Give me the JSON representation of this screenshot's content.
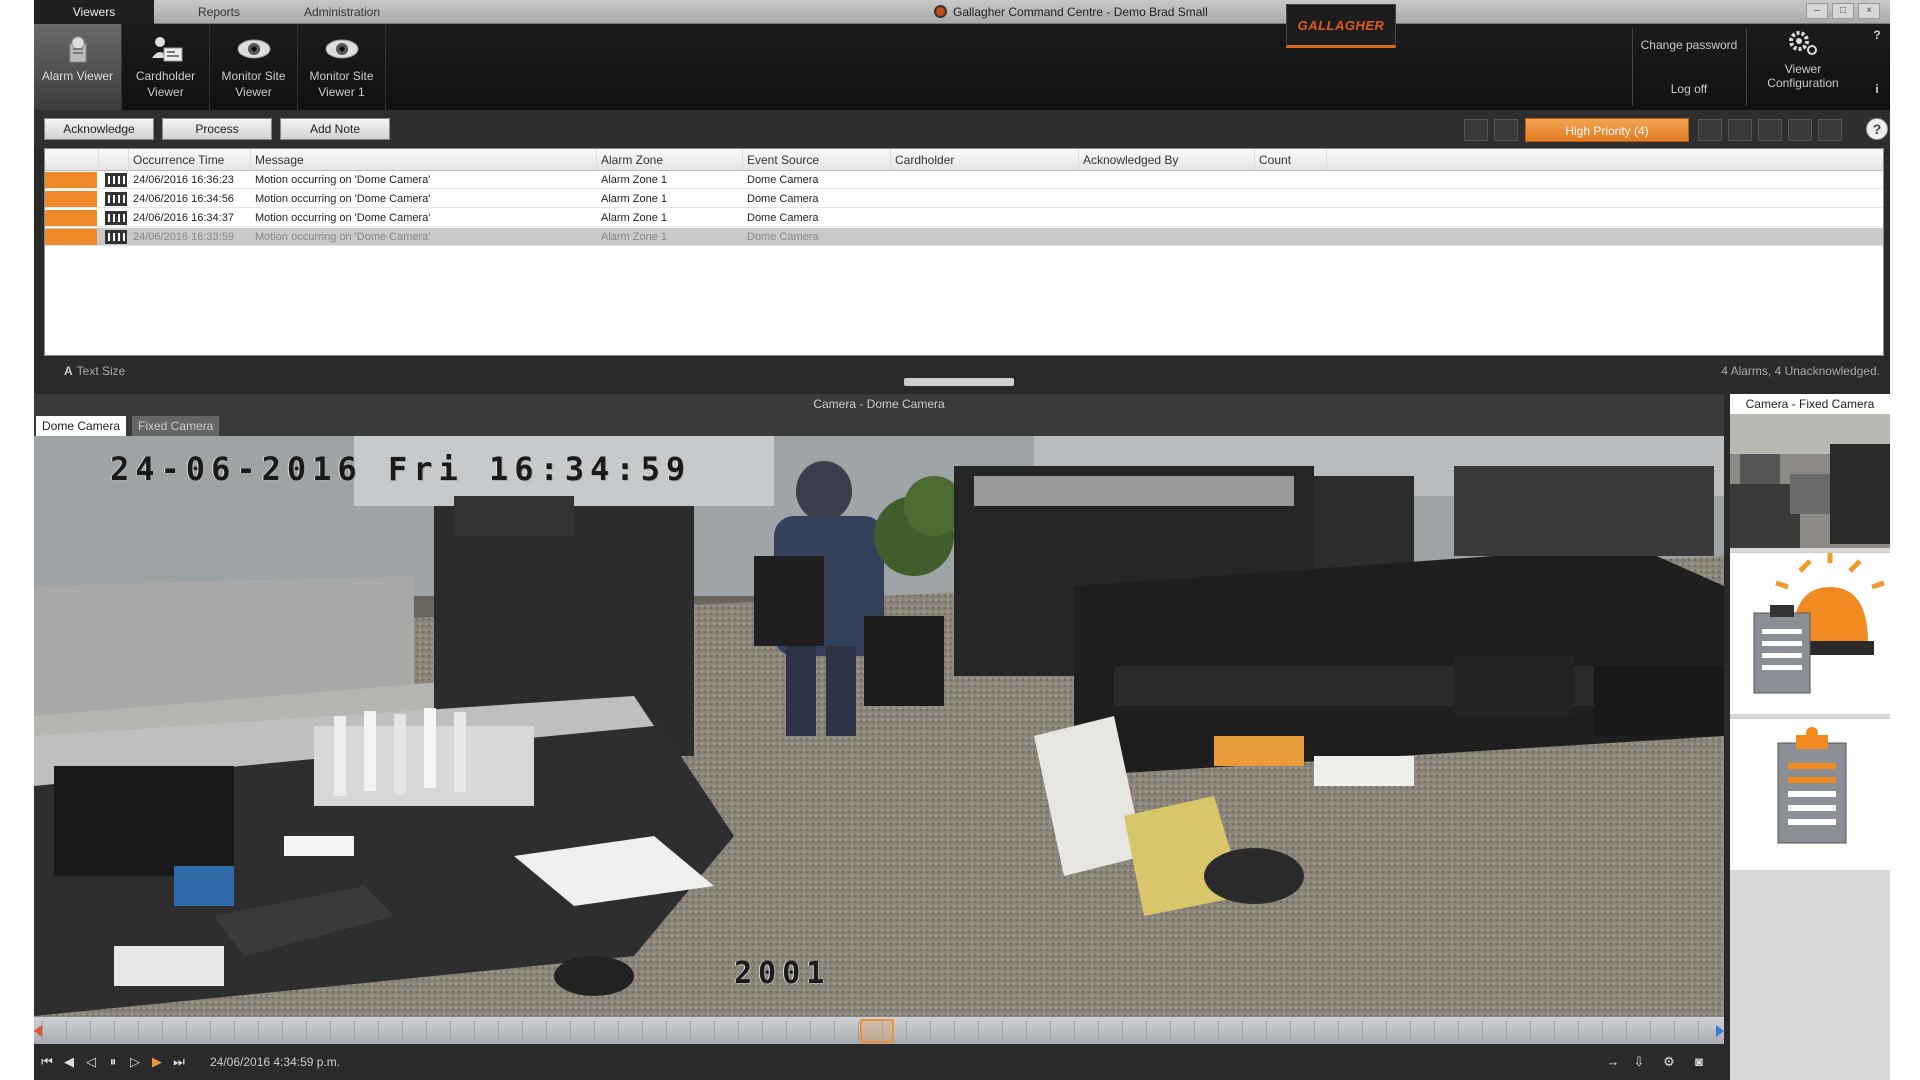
{
  "menu": {
    "tabs": [
      "Viewers",
      "Reports",
      "Administration"
    ],
    "active": "Viewers"
  },
  "app_title": "Gallagher Command Centre - Demo Brad Small",
  "logo_text": "GALLAGHER",
  "window_buttons": [
    "–",
    "□",
    "×"
  ],
  "toolbar": {
    "tools": [
      {
        "label": "Alarm Viewer",
        "icon": "alarm-viewer-icon"
      },
      {
        "label": "Cardholder Viewer",
        "icon": "cardholder-icon"
      },
      {
        "label": "Monitor Site Viewer",
        "icon": "eye-icon"
      },
      {
        "label": "Monitor Site Viewer 1",
        "icon": "eye-icon"
      }
    ],
    "change_password": "Change password",
    "log_off": "Log off",
    "viewer_configuration": "Viewer Configuration",
    "help": "?",
    "info": "i"
  },
  "actions": {
    "acknowledge": "Acknowledge",
    "process": "Process",
    "add_note": "Add Note",
    "high_priority": "High Priority (4)",
    "help": "?"
  },
  "alarm_table": {
    "columns": [
      "Occurrence Time",
      "Message",
      "Alarm Zone",
      "Event Source",
      "Cardholder",
      "Acknowledged By",
      "Count"
    ],
    "rows": [
      {
        "time": "24/06/2016 16:36:23",
        "message": "Motion occurring on 'Dome Camera'",
        "zone": "Alarm Zone 1",
        "source": "Dome Camera",
        "cardholder": "",
        "ack_by": "",
        "count": ""
      },
      {
        "time": "24/06/2016 16:34:56",
        "message": "Motion occurring on 'Dome Camera'",
        "zone": "Alarm Zone 1",
        "source": "Dome Camera",
        "cardholder": "",
        "ack_by": "",
        "count": ""
      },
      {
        "time": "24/06/2016 16:34:37",
        "message": "Motion occurring on 'Dome Camera'",
        "zone": "Alarm Zone 1",
        "source": "Dome Camera",
        "cardholder": "",
        "ack_by": "",
        "count": ""
      },
      {
        "time": "24/06/2016 16:33:59",
        "message": "Motion occurring on 'Dome Camera'",
        "zone": "Alarm Zone 1",
        "source": "Dome Camera",
        "cardholder": "",
        "ack_by": "",
        "count": ""
      }
    ],
    "selected_row": 3
  },
  "status": {
    "text_size": "Text Size",
    "summary": "4 Alarms, 4 Unacknowledged."
  },
  "camera": {
    "title": "Camera - Dome Camera",
    "tabs": [
      "Dome Camera",
      "Fixed Camera"
    ],
    "active_tab": "Dome Camera",
    "osd_timestamp": "24-06-2016 Fri 16:34:59",
    "osd_label": "2001",
    "playback_time": "24/06/2016 4:34:59 p.m."
  },
  "side_panel": {
    "title": "Camera - Fixed Camera"
  },
  "colors": {
    "priority_orange": "#ef8a2a",
    "brand_orange": "#e05a1c",
    "toolbar_dark": "#101010"
  }
}
